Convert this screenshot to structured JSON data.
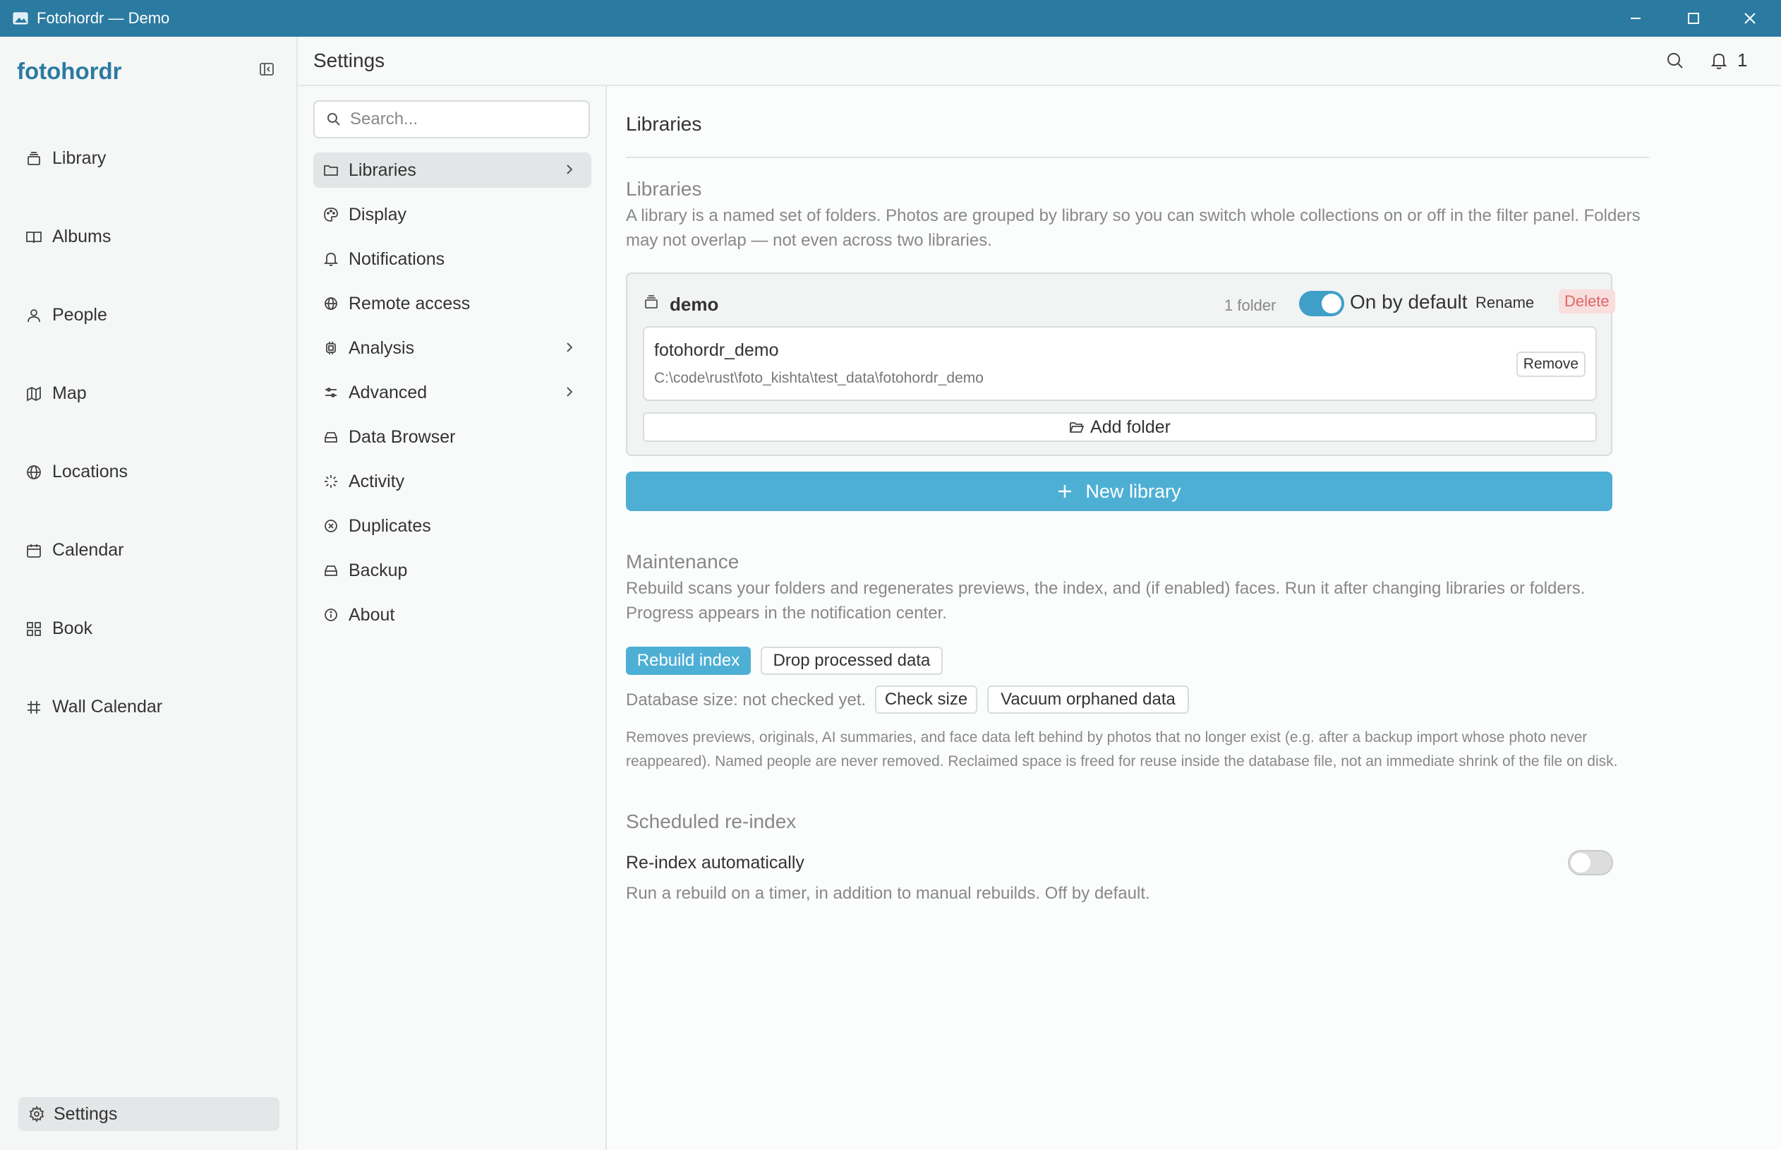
{
  "window": {
    "title": "Fotohordr — Demo"
  },
  "sidebar": {
    "brand": "fotohordr",
    "items": [
      {
        "label": "Library"
      },
      {
        "label": "Albums"
      },
      {
        "label": "People"
      },
      {
        "label": "Map"
      },
      {
        "label": "Locations"
      },
      {
        "label": "Calendar"
      },
      {
        "label": "Book"
      },
      {
        "label": "Wall Calendar"
      }
    ],
    "settings_label": "Settings"
  },
  "header": {
    "title": "Settings",
    "notification_count": "1"
  },
  "settings_nav": {
    "search_placeholder": "Search...",
    "items": [
      {
        "label": "Libraries"
      },
      {
        "label": "Display"
      },
      {
        "label": "Notifications"
      },
      {
        "label": "Remote access"
      },
      {
        "label": "Analysis"
      },
      {
        "label": "Advanced"
      },
      {
        "label": "Data Browser"
      },
      {
        "label": "Activity"
      },
      {
        "label": "Duplicates"
      },
      {
        "label": "Backup"
      },
      {
        "label": "About"
      }
    ]
  },
  "content": {
    "title": "Libraries",
    "libraries_section": {
      "title": "Libraries",
      "description": "A library is a named set of folders. Photos are grouped by library so you can switch whole collections on or off in the filter panel. Folders may not overlap — not even across two libraries.",
      "library": {
        "name": "demo",
        "folder_count": "1 folder",
        "default_label": "On by default",
        "default_on": true,
        "rename_label": "Rename",
        "delete_label": "Delete",
        "folder": {
          "name": "fotohordr_demo",
          "path": "C:\\code\\rust\\foto_kishta\\test_data\\fotohordr_demo",
          "remove_label": "Remove"
        },
        "add_folder_label": "Add folder"
      },
      "new_library_label": "New library"
    },
    "maintenance": {
      "title": "Maintenance",
      "description": "Rebuild scans your folders and regenerates previews, the index, and (if enabled) faces. Run it after changing libraries or folders. Progress appears in the notification center.",
      "rebuild_label": "Rebuild index",
      "drop_label": "Drop processed data",
      "db_size": "Database size: not checked yet.",
      "check_size_label": "Check size",
      "vacuum_label": "Vacuum orphaned data",
      "note": "Removes previews, originals, AI summaries, and face data left behind by photos that no longer exist (e.g. after a backup import whose photo never reappeared). Named people are never removed. Reclaimed space is freed for reuse inside the database file, not an immediate shrink of the file on disk."
    },
    "scheduled": {
      "title": "Scheduled re-index",
      "label": "Re-index automatically",
      "description": "Run a rebuild on a timer, in addition to manual rebuilds. Off by default.",
      "enabled": false
    }
  },
  "colors": {
    "titlebar": "#2b7aa1",
    "brand": "#2b7aa1",
    "accent": "#4eafd5",
    "delete": "#e06666"
  }
}
